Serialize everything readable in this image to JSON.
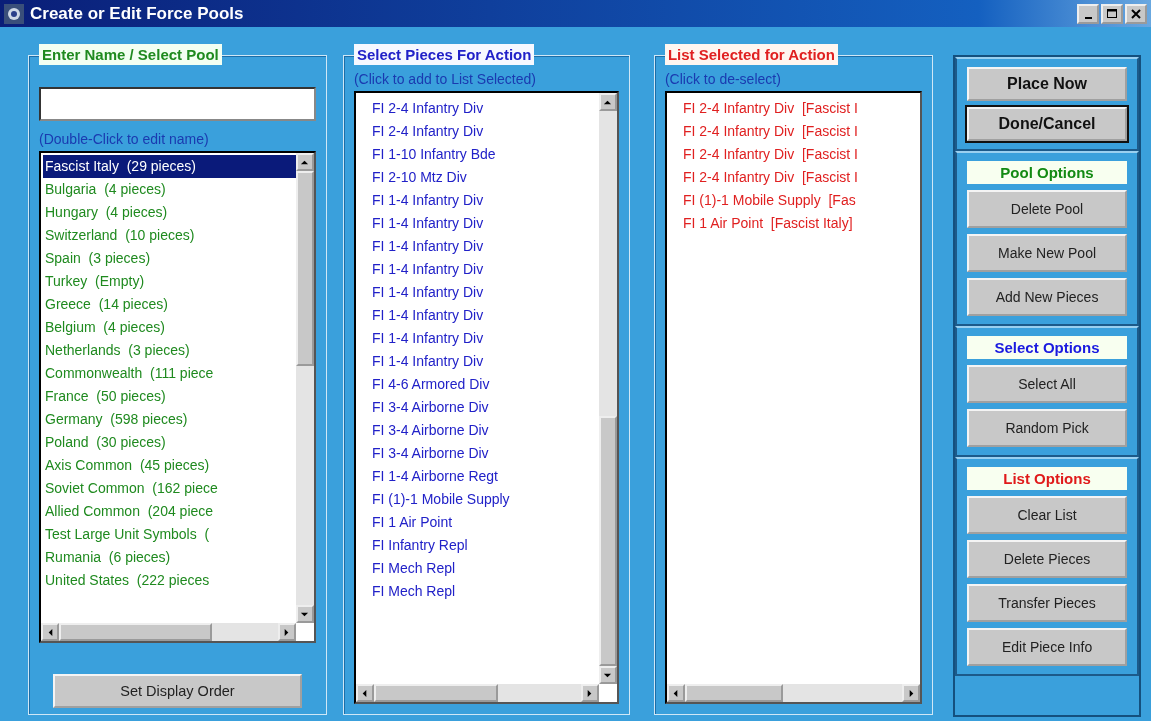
{
  "window": {
    "title": "Create or Edit Force Pools"
  },
  "pool_panel": {
    "title": "Enter Name / Select Pool",
    "hint": "(Double-Click to edit name)",
    "pools": [
      {
        "label": "Fascist Italy  (29 pieces)",
        "selected": true
      },
      {
        "label": "Bulgaria  (4 pieces)",
        "selected": false
      },
      {
        "label": "Hungary  (4 pieces)",
        "selected": false
      },
      {
        "label": "Switzerland  (10 pieces)",
        "selected": false
      },
      {
        "label": "Spain  (3 pieces)",
        "selected": false
      },
      {
        "label": "Turkey  (Empty)",
        "selected": false
      },
      {
        "label": "Greece  (14 pieces)",
        "selected": false
      },
      {
        "label": "Belgium  (4 pieces)",
        "selected": false
      },
      {
        "label": "Netherlands  (3 pieces)",
        "selected": false
      },
      {
        "label": "Commonwealth  (111 piece",
        "selected": false
      },
      {
        "label": "France  (50 pieces)",
        "selected": false
      },
      {
        "label": "Germany  (598 pieces)",
        "selected": false
      },
      {
        "label": "Poland  (30 pieces)",
        "selected": false
      },
      {
        "label": "Axis Common  (45 pieces)",
        "selected": false
      },
      {
        "label": "Soviet Common  (162 piece",
        "selected": false
      },
      {
        "label": "Allied Common  (204 piece",
        "selected": false
      },
      {
        "label": "Test Large Unit Symbols  (",
        "selected": false
      },
      {
        "label": "Rumania  (6 pieces)",
        "selected": false
      },
      {
        "label": "United States  (222 pieces",
        "selected": false
      }
    ],
    "button": "Set Display Order"
  },
  "pieces_panel": {
    "title": "Select Pieces For Action",
    "hint": "(Click to add to List Selected)",
    "items": [
      "FI 2-4 Infantry Div",
      "FI 2-4 Infantry Div",
      "FI 1-10 Infantry Bde",
      "FI 2-10 Mtz Div",
      "FI 1-4 Infantry Div",
      "FI 1-4 Infantry Div",
      "FI 1-4 Infantry Div",
      "FI 1-4 Infantry Div",
      "FI 1-4 Infantry Div",
      "FI 1-4 Infantry Div",
      "FI 1-4 Infantry Div",
      "FI 1-4 Infantry Div",
      "FI 4-6 Armored Div",
      "FI 3-4 Airborne Div",
      "FI 3-4 Airborne Div",
      "FI 3-4 Airborne Div",
      "FI 1-4 Airborne Regt",
      "FI (1)-1 Mobile Supply",
      "FI 1 Air Point",
      "FI Infantry Repl",
      "FI Mech Repl",
      "FI Mech Repl"
    ]
  },
  "selected_panel": {
    "title": "List Selected for Action",
    "hint": "(Click to de-select)",
    "items": [
      "FI 2-4 Infantry Div  [Fascist I",
      "FI 2-4 Infantry Div  [Fascist I",
      "FI 2-4 Infantry Div  [Fascist I",
      "FI 2-4 Infantry Div  [Fascist I",
      "FI (1)-1 Mobile Supply  [Fas",
      "FI 1 Air Point  [Fascist Italy]"
    ]
  },
  "actions": {
    "top_buttons": [
      {
        "label": "Place Now",
        "default": false
      },
      {
        "label": "Done/Cancel",
        "default": true
      }
    ],
    "groups": [
      {
        "title": "Pool Options",
        "color": "#138a13",
        "buttons": [
          "Delete Pool",
          "Make New Pool",
          "Add New Pieces"
        ]
      },
      {
        "title": "Select Options",
        "color": "#1a1ae0",
        "buttons": [
          "Select All",
          "Random Pick"
        ]
      },
      {
        "title": "List Options",
        "color": "#e01a1a",
        "buttons": [
          "Clear List",
          "Delete Pieces",
          "Transfer Pieces",
          "Edit Piece Info"
        ]
      }
    ]
  }
}
